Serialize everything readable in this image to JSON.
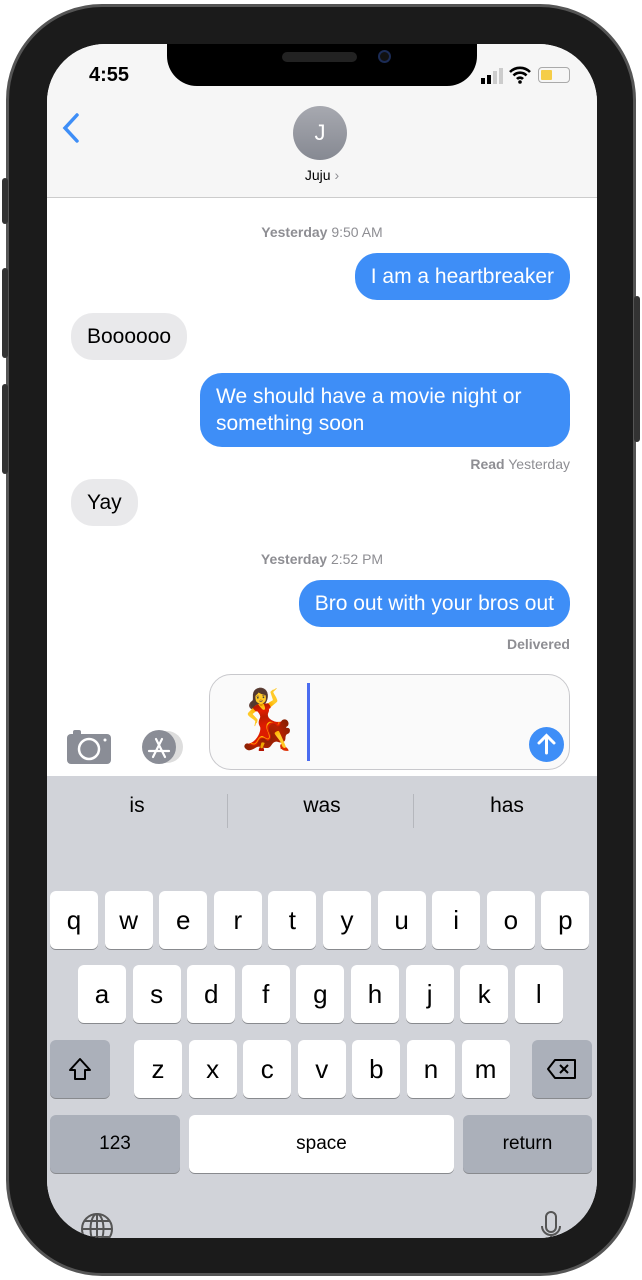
{
  "status_bar": {
    "time": "4:55",
    "battery_color": "#f5cd47"
  },
  "header": {
    "back_icon": "chevron-left-icon",
    "avatar_initial": "J",
    "contact_name": "Juju",
    "chevron": "›"
  },
  "messages": [
    {
      "type": "timestamp",
      "day": "Yesterday",
      "time": "9:50 AM"
    },
    {
      "type": "outgoing",
      "text": "I am a heartbreaker"
    },
    {
      "type": "incoming",
      "text": "Boooooo"
    },
    {
      "type": "outgoing",
      "text": "We should have a movie night or something soon"
    },
    {
      "type": "status",
      "bold": "Read",
      "text": "Yesterday"
    },
    {
      "type": "incoming",
      "text": "Yay"
    },
    {
      "type": "timestamp",
      "day": "Yesterday",
      "time": "2:52 PM"
    },
    {
      "type": "outgoing",
      "text": "Bro out with your bros out"
    },
    {
      "type": "status",
      "bold": "Delivered",
      "text": ""
    }
  ],
  "composer": {
    "content": "💃",
    "camera_icon": "camera-icon",
    "apps_icon": "app-store-icon",
    "send_icon": "arrow-up-icon"
  },
  "keyboard": {
    "suggestions": [
      "is",
      "was",
      "has"
    ],
    "row1": [
      "q",
      "w",
      "e",
      "r",
      "t",
      "y",
      "u",
      "i",
      "o",
      "p"
    ],
    "row2": [
      "a",
      "s",
      "d",
      "f",
      "g",
      "h",
      "j",
      "k",
      "l"
    ],
    "row3": [
      "z",
      "x",
      "c",
      "v",
      "b",
      "n",
      "m"
    ],
    "shift_icon": "shift-icon",
    "delete_icon": "delete-icon",
    "numbers": "123",
    "space": "space",
    "return": "return",
    "globe_icon": "globe-icon",
    "mic_icon": "microphone-icon"
  },
  "colors": {
    "accent": "#3e8ef7",
    "incoming": "#e9e9eb"
  }
}
